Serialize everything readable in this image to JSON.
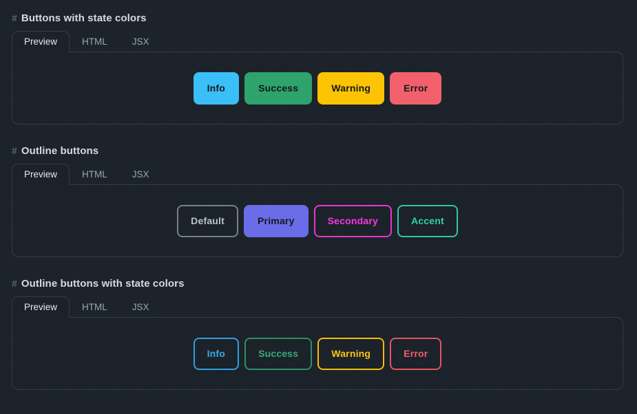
{
  "theme": {
    "page_background": "#1d232a",
    "panel_background": "#1c2229",
    "panel_border": "#343c47",
    "heading_color": "#d6dbe3",
    "hash_color": "#5a6575",
    "tab_inactive_color": "#9aa5b4",
    "tab_active_color": "#e4e9f0",
    "solid_button_text": "#13181d"
  },
  "tabs": {
    "items": [
      {
        "label": "Preview",
        "active": true
      },
      {
        "label": "HTML",
        "active": false
      },
      {
        "label": "JSX",
        "active": false
      }
    ]
  },
  "sections": [
    {
      "id": "buttons-with-state-colors",
      "hash": "#",
      "title": "Buttons with state colors",
      "buttons": [
        {
          "label": "Info",
          "style": "solid",
          "color": "#3abff8",
          "text_color": "#13181d"
        },
        {
          "label": "Success",
          "style": "solid",
          "color": "#2ea36b",
          "text_color": "#13181d"
        },
        {
          "label": "Warning",
          "style": "solid",
          "color": "#fcc404",
          "text_color": "#13181d"
        },
        {
          "label": "Error",
          "style": "solid",
          "color": "#f2616b",
          "text_color": "#13181d"
        }
      ]
    },
    {
      "id": "outline-buttons",
      "hash": "#",
      "title": "Outline buttons",
      "buttons": [
        {
          "label": "Default",
          "style": "outline",
          "color": "#77808f",
          "text_color": "#bcc4d0"
        },
        {
          "label": "Primary",
          "style": "solid",
          "color": "#6b6ce8",
          "text_color": "#13181d"
        },
        {
          "label": "Secondary",
          "style": "outline",
          "color": "#e935d4",
          "text_color": "#f637e3"
        },
        {
          "label": "Accent",
          "style": "outline",
          "color": "#2ec8a6",
          "text_color": "#2fd3ae"
        }
      ]
    },
    {
      "id": "outline-buttons-with-state-colors",
      "hash": "#",
      "title": "Outline buttons with state colors",
      "buttons": [
        {
          "label": "Info",
          "style": "outline",
          "color": "#2f9fe0",
          "text_color": "#3ba9e8"
        },
        {
          "label": "Success",
          "style": "outline",
          "color": "#2d8f63",
          "text_color": "#37ab77"
        },
        {
          "label": "Warning",
          "style": "outline",
          "color": "#f5bd07",
          "text_color": "#f9c80f"
        },
        {
          "label": "Error",
          "style": "outline",
          "color": "#e25563",
          "text_color": "#ef5f6e"
        }
      ]
    }
  ]
}
